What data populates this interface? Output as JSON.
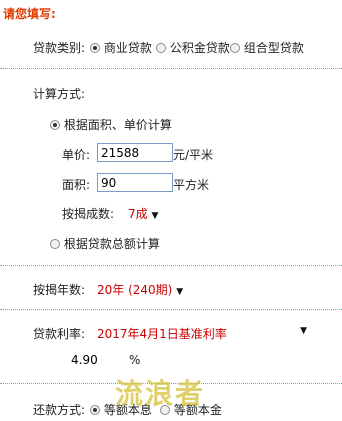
{
  "header": {
    "title": "请您填写:"
  },
  "loan_type": {
    "label": "贷款类别:",
    "options": [
      "商业贷款",
      "公积金贷款",
      "组合型贷款"
    ],
    "selected": 0
  },
  "calc_method": {
    "label": "计算方式:",
    "option_area": "根据面积、单价计算",
    "option_total": "根据贷款总额计算",
    "unit_price_label": "单价:",
    "unit_price_value": "21588",
    "unit_price_unit": "元/平米",
    "area_label": "面积:",
    "area_value": "90",
    "area_unit": "平方米",
    "ratio_label": "按揭成数:",
    "ratio_value": "7成"
  },
  "years": {
    "label": "按揭年数:",
    "value": "20年 (240期)"
  },
  "rate": {
    "label": "贷款利率:",
    "value": "2017年4月1日基准利率",
    "rate_value": "4.90",
    "rate_unit": "%"
  },
  "repay": {
    "label": "还款方式:",
    "option_1": "等额本息",
    "option_2": "等额本金"
  },
  "watermark": "流浪者"
}
